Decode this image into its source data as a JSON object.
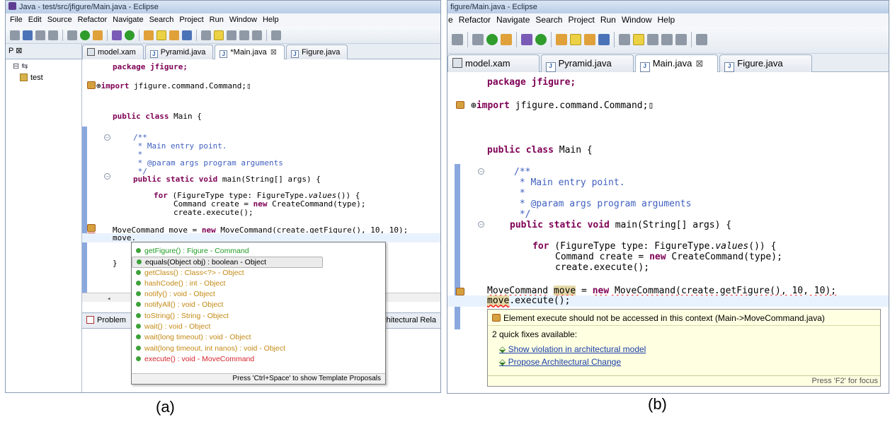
{
  "panel_a": {
    "window_title": "Java - test/src/jfigure/Main.java - Eclipse",
    "menu": [
      "File",
      "Edit",
      "Source",
      "Refactor",
      "Navigate",
      "Search",
      "Project",
      "Run",
      "Window",
      "Help"
    ],
    "explorer_tab": "P",
    "explorer_tab_close": "⊠",
    "project": "test",
    "editor_tabs": [
      {
        "label": "model.xam",
        "icon": "model-icon"
      },
      {
        "label": "Pyramid.java",
        "icon": "java-file-icon"
      },
      {
        "label": "*Main.java",
        "icon": "java-file-icon",
        "active": true,
        "close": "⊠"
      },
      {
        "label": "Figure.java",
        "icon": "java-file-icon"
      }
    ],
    "code": {
      "package": "package jfigure;",
      "import_kw": "import",
      "import_rest": " jfigure.command.Command;",
      "class_kw": "public class",
      "class_rest": " Main {",
      "doc1": "/**",
      "doc2": " * Main entry point.",
      "doc3": " *",
      "doc4": " * @param args program arguments",
      "doc5": " */",
      "main_kw": "public static void",
      "main_rest": " main(String[] args) {",
      "for_kw": "for",
      "for_mid": " (FigureType type: FigureType.",
      "for_it": "values",
      "for_end": "()) {",
      "cmd_pre": "Command create = ",
      "cmd_kw": "new",
      "cmd_post": " CreateCommand(type);",
      "exec": "create.execute();",
      "move_decl_pre": "MoveCommand move = ",
      "move_decl_kw": "new",
      "move_decl_post": " MoveCommand(create.getFigure(), 10, 10);",
      "move_partial": "move.",
      "brace_inner": "}",
      "brace_outer": "}"
    },
    "completions": [
      {
        "text": "getFigure() : Figure - Command",
        "style": "green"
      },
      {
        "text": "equals(Object obj) : boolean - Object",
        "style": "black",
        "selected": true
      },
      {
        "text": "getClass() : Class<?> - Object",
        "style": "orange"
      },
      {
        "text": "hashCode() : int - Object",
        "style": "orange"
      },
      {
        "text": "notify() : void - Object",
        "style": "orange"
      },
      {
        "text": "notifyAll() : void - Object",
        "style": "orange"
      },
      {
        "text": "toString() : String - Object",
        "style": "orange"
      },
      {
        "text": "wait() : void - Object",
        "style": "orange"
      },
      {
        "text": "wait(long timeout) : void - Object",
        "style": "orange"
      },
      {
        "text": "wait(long timeout, int nanos) : void - Object",
        "style": "orange"
      },
      {
        "text": "execute() : void - MoveCommand",
        "style": "red"
      }
    ],
    "completion_footer": "Press 'Ctrl+Space' to show Template Proposals",
    "bottom_tab_1": "Problem",
    "bottom_tab_2": "chitectural Rela",
    "caption": "(a)"
  },
  "panel_b": {
    "window_title": "figure/Main.java - Eclipse",
    "menu": [
      "e",
      "Refactor",
      "Navigate",
      "Search",
      "Project",
      "Run",
      "Window",
      "Help"
    ],
    "editor_tabs": [
      {
        "label": "model.xam",
        "icon": "model-icon"
      },
      {
        "label": "Pyramid.java",
        "icon": "java-file-icon"
      },
      {
        "label": "Main.java",
        "icon": "java-file-icon",
        "active": true,
        "close": "⊠"
      },
      {
        "label": "Figure.java",
        "icon": "java-file-icon"
      }
    ],
    "code": {
      "package": "package jfigure;",
      "import_kw": "import",
      "import_rest": " jfigure.command.Command;",
      "class_kw": "public class",
      "class_rest": " Main {",
      "doc1": "/**",
      "doc2": " * Main entry point.",
      "doc3": " *",
      "doc4": " * @param args program arguments",
      "doc5": " */",
      "main_kw": "public static void",
      "main_rest": " main(String[] args) {",
      "for_kw": "for",
      "for_mid": " (FigureType type: FigureType.",
      "for_it": "values",
      "for_end": "()) {",
      "cmd_pre": "Command create = ",
      "cmd_kw": "new",
      "cmd_post": " CreateCommand(type);",
      "exec": "create.execute();",
      "move_type": "MoveCommand",
      "move_var": "move",
      "move_eq": " = ",
      "move_kw": "new",
      "move_post": " MoveCommand(create.getFigure(), 10, 10);",
      "move_call_var": "move",
      "move_call_rest": ".execute();"
    },
    "hover": {
      "message": "Element execute should not be accessed in this context (Main->MoveCommand.java)",
      "fix_count": "2 quick fixes available:",
      "fixes": [
        "Show violation in architectural model",
        "Propose Architectural Change"
      ],
      "footer": "Press 'F2' for focus"
    },
    "caption": "(b)"
  },
  "colors": {
    "keyword": "#7f0055",
    "javadoc": "#3f5fbf",
    "error": "#d64b3b",
    "link": "#1a3fa8"
  }
}
